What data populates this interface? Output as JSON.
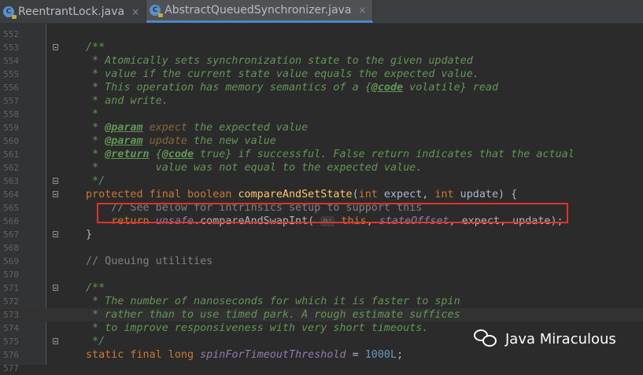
{
  "tabs": [
    {
      "label": "ReentrantLock.java",
      "active": false
    },
    {
      "label": "AbstractQueuedSynchronizer.java",
      "active": true
    }
  ],
  "icons": {
    "file": "java-class-icon",
    "close": "close-icon",
    "fold": "fold-icon",
    "watermark": "wechat-icon"
  },
  "file_icon_letter": "C",
  "close_glyph": "×",
  "param_hint": "o:",
  "colors": {
    "background": "#2b2b2b",
    "keyword": "#cc7832",
    "doc_comment": "#629755",
    "field": "#9876aa",
    "method": "#ffc66d",
    "number": "#6897bb",
    "highlight_box": "#e0342a"
  },
  "lines": [
    {
      "n": "552",
      "parts": []
    },
    {
      "n": "553",
      "parts": [
        [
          "doc",
          "/**"
        ]
      ],
      "fold": true
    },
    {
      "n": "554",
      "parts": [
        [
          "doc",
          " * Atomically sets synchronization state to the given updated"
        ]
      ]
    },
    {
      "n": "555",
      "parts": [
        [
          "doc",
          " * value if the current state value equals the expected value."
        ]
      ]
    },
    {
      "n": "556",
      "parts": [
        [
          "doc",
          " * This operation has memory semantics of a {"
        ],
        [
          "doctag",
          "@code"
        ],
        [
          "doc",
          " volatile} read"
        ]
      ]
    },
    {
      "n": "557",
      "parts": [
        [
          "doc",
          " * and write."
        ]
      ]
    },
    {
      "n": "558",
      "parts": [
        [
          "doc",
          " *"
        ]
      ]
    },
    {
      "n": "559",
      "parts": [
        [
          "doc",
          " * "
        ],
        [
          "doctag",
          "@param"
        ],
        [
          "docparam",
          " expect"
        ],
        [
          "doc",
          " the expected value"
        ]
      ]
    },
    {
      "n": "560",
      "parts": [
        [
          "doc",
          " * "
        ],
        [
          "doctag",
          "@param"
        ],
        [
          "docparam",
          " update"
        ],
        [
          "doc",
          " the new value"
        ]
      ]
    },
    {
      "n": "561",
      "parts": [
        [
          "doc",
          " * "
        ],
        [
          "doctag",
          "@return"
        ],
        [
          "doc",
          " {"
        ],
        [
          "doctag",
          "@code"
        ],
        [
          "doc",
          " true} if successful. False return indicates that the actual"
        ]
      ]
    },
    {
      "n": "562",
      "parts": [
        [
          "doc",
          " *         value was not equal to the expected value."
        ]
      ]
    },
    {
      "n": "563",
      "parts": [
        [
          "doc",
          " */"
        ]
      ],
      "fold": true
    },
    {
      "n": "564",
      "parts": [
        [
          "kw",
          "protected final boolean "
        ],
        [
          "meth",
          "compareAndSetState"
        ],
        [
          "txt",
          "("
        ],
        [
          "kw",
          "int "
        ],
        [
          "txt",
          "expect, "
        ],
        [
          "kw",
          "int "
        ],
        [
          "txt",
          "update) {"
        ]
      ],
      "fold": true
    },
    {
      "n": "565",
      "parts": [
        [
          "lc",
          "    // See below for intrinsics setup to support this"
        ]
      ]
    },
    {
      "n": "566",
      "parts": [
        [
          "kw",
          "    return "
        ],
        [
          "field",
          "unsafe"
        ],
        [
          "txt",
          ".compareAndSwapInt( "
        ],
        [
          "hint",
          "o:"
        ],
        [
          "kw",
          " this"
        ],
        [
          "txt",
          ", "
        ],
        [
          "field",
          "stateOffset"
        ],
        [
          "txt",
          ", expect, update);"
        ]
      ]
    },
    {
      "n": "567",
      "parts": [
        [
          "txt",
          "}"
        ]
      ],
      "fold": true
    },
    {
      "n": "568",
      "parts": []
    },
    {
      "n": "569",
      "parts": [
        [
          "lc",
          "// Queuing utilities"
        ]
      ]
    },
    {
      "n": "570",
      "parts": []
    },
    {
      "n": "571",
      "parts": [
        [
          "doc",
          "/**"
        ]
      ],
      "fold": true
    },
    {
      "n": "572",
      "parts": [
        [
          "doc",
          " * The number of nanoseconds for which it is faster to spin"
        ]
      ]
    },
    {
      "n": "573",
      "parts": [
        [
          "doc",
          " * rather than to use timed park. A rough estimate suffices"
        ]
      ],
      "current": true
    },
    {
      "n": "574",
      "parts": [
        [
          "doc",
          " * to improve responsiveness with very short timeouts."
        ]
      ]
    },
    {
      "n": "575",
      "parts": [
        [
          "doc",
          " */"
        ]
      ],
      "fold": true
    },
    {
      "n": "576",
      "parts": [
        [
          "kw",
          "static final long "
        ],
        [
          "field",
          "spinForTimeoutThreshold"
        ],
        [
          "txt",
          " = "
        ],
        [
          "num",
          "1000L"
        ],
        [
          "txt",
          ";"
        ]
      ]
    },
    {
      "n": "577",
      "parts": []
    }
  ],
  "watermark": {
    "text": "Java Miraculous"
  }
}
